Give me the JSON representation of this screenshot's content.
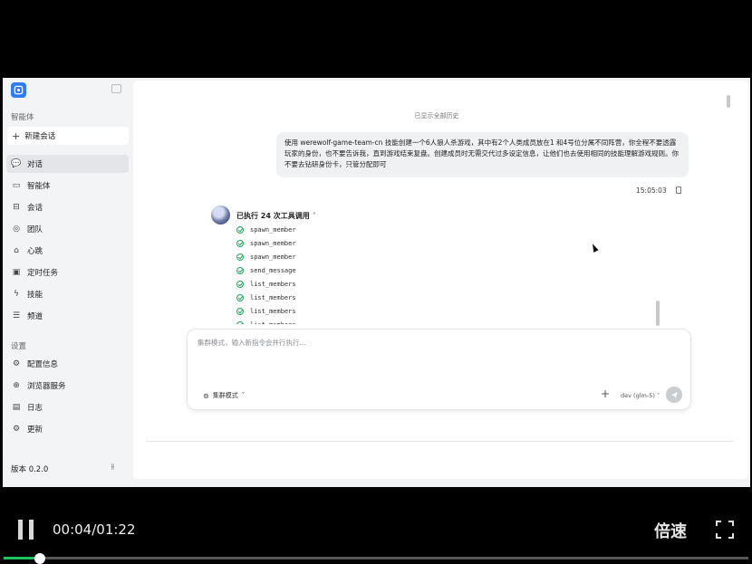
{
  "sidebar": {
    "section_agents": "智能体",
    "new_chat": "新建会话",
    "nav": [
      {
        "label": "对话",
        "icon": "chat-bubble-icon",
        "active": true
      },
      {
        "label": "智能体",
        "icon": "monitor-icon"
      },
      {
        "label": "会话",
        "icon": "session-icon"
      },
      {
        "label": "团队",
        "icon": "team-icon"
      },
      {
        "label": "心跳",
        "icon": "heartbeat-icon"
      },
      {
        "label": "定时任务",
        "icon": "calendar-icon"
      },
      {
        "label": "技能",
        "icon": "lightning-icon"
      },
      {
        "label": "频道",
        "icon": "list-icon"
      }
    ],
    "section_settings": "设置",
    "settings": [
      {
        "label": "配置信息",
        "icon": "gear-icon"
      },
      {
        "label": "浏览器服务",
        "icon": "globe-icon"
      },
      {
        "label": "日志",
        "icon": "log-icon"
      },
      {
        "label": "更新",
        "icon": "update-gear-icon"
      }
    ],
    "version": "版本 0.2.0"
  },
  "chat": {
    "history_note": "已显示全部历史",
    "user_message": "使用 werewolf-game-team-cn 技能创建一个6人狼人杀游戏，其中有2个人类成员放在1 和4号位分属不同阵营，你全程不要透露玩家的身份，也不要告诉我，直到游戏结束复盘。创建成员时无需交代过多设定信息，让他们也去使用相同的技能理解游戏规则。你不要去钻研身份卡，只管分配即可",
    "timestamp": "15:05:03",
    "tool_summary": "已执行 24 次工具调用",
    "tools": [
      "spawn_member",
      "spawn_member",
      "spawn_member",
      "send_message",
      "list_members",
      "list_members",
      "list_members",
      "list_members"
    ]
  },
  "composer": {
    "placeholder": "集群模式，输入新指令会并行执行...",
    "mode_label": "集群模式",
    "model": "dev (glm-5)"
  },
  "player": {
    "time": "00:04/01:22",
    "speed_label": "倍速",
    "progress_fraction": 0.049,
    "accent": "#21c35b"
  }
}
